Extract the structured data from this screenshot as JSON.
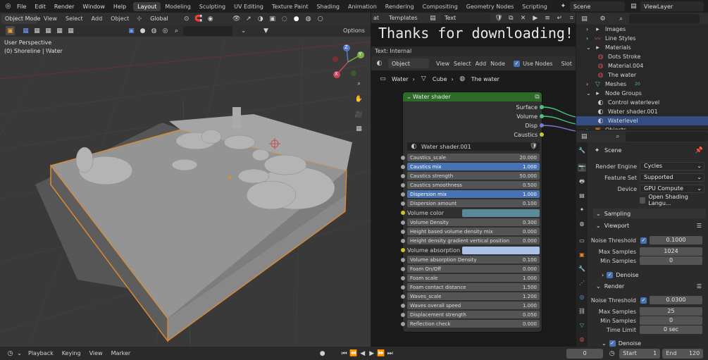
{
  "topbar": {
    "menus": [
      "File",
      "Edit",
      "Render",
      "Window",
      "Help"
    ],
    "workspaces": [
      "Layout",
      "Modeling",
      "Sculpting",
      "UV Editing",
      "Texture Paint",
      "Shading",
      "Animation",
      "Rendering",
      "Compositing",
      "Geometry Nodes",
      "Scripting"
    ],
    "active_workspace": "Layout",
    "scene": "Scene",
    "view_layer": "ViewLayer"
  },
  "viewport": {
    "mode": "Object Mode",
    "menus": [
      "View",
      "Select",
      "Add",
      "Object"
    ],
    "transform_orientation": "Global",
    "options_label": "Options",
    "overlay_title": "User Perspective",
    "overlay_subtitle": "(0) Shoreline | Water",
    "gizmo_axes": [
      "Z",
      "Y",
      "X"
    ]
  },
  "text_editor": {
    "label": "at",
    "templates": "Templates",
    "text_menu": "Text",
    "content": "Thanks for downloading!",
    "status": "Text: Internal"
  },
  "node_editor": {
    "object_mode": "Object",
    "menus": [
      "View",
      "Select",
      "Add",
      "Node"
    ],
    "use_nodes_label": "Use Nodes",
    "slot_label": "Slot",
    "breadcrumb": [
      "Water",
      "Cube",
      "The water"
    ],
    "node": {
      "title": "Water shader",
      "outputs": [
        "Surface",
        "Volume",
        "Disp",
        "Caustics"
      ],
      "group_name": "Water shader.001",
      "inputs": [
        {
          "label": "Caustics_scale",
          "value": "20.000",
          "selected": false
        },
        {
          "label": "Caustics mix",
          "value": "1.000",
          "selected": true
        },
        {
          "label": "Caustics strength",
          "value": "50.000",
          "selected": false
        },
        {
          "label": "Caustics smoothness",
          "value": "0.500",
          "selected": false
        },
        {
          "label": "Dispersion mix",
          "value": "1.000",
          "selected": true
        },
        {
          "label": "Dispersion amount",
          "value": "0.100",
          "selected": false
        }
      ],
      "volume_color_label": "Volume color",
      "volume_color": "#5a8a9a",
      "inputs2": [
        {
          "label": "Volume Density",
          "value": "0.300"
        },
        {
          "label": "Height based volume density mix",
          "value": "0.000"
        },
        {
          "label": "Height density gradient vertical position",
          "value": "0.000"
        }
      ],
      "absorption_color_label": "Volume absorption color",
      "absorption_color": "#aac2e6",
      "inputs3": [
        {
          "label": "Volume absorption Density",
          "value": "0.100"
        },
        {
          "label": "Foam On/Off",
          "value": "0.000"
        },
        {
          "label": "Foam scale",
          "value": "1.000"
        },
        {
          "label": "Foam contact distance",
          "value": "1.500"
        },
        {
          "label": "Waves_scale",
          "value": "1.200"
        },
        {
          "label": "Waves overall speed",
          "value": "1.000"
        },
        {
          "label": "Displacement strength",
          "value": "0.050"
        },
        {
          "label": "Reflection check",
          "value": "0.000"
        }
      ]
    }
  },
  "outliner": {
    "items": [
      {
        "label": "Images",
        "indent": 2,
        "icon": "folder-icon"
      },
      {
        "label": "Line Styles",
        "indent": 2,
        "icon": "linestyle-icon"
      },
      {
        "label": "Materials",
        "indent": 2,
        "icon": "folder-icon"
      },
      {
        "label": "Dots Stroke",
        "indent": 4,
        "icon": "material-icon"
      },
      {
        "label": "Material.004",
        "indent": 4,
        "icon": "material-icon"
      },
      {
        "label": "The water",
        "indent": 4,
        "icon": "material-icon"
      },
      {
        "label": "Meshes",
        "indent": 2,
        "icon": "mesh-icon",
        "badge": "20"
      },
      {
        "label": "Node Groups",
        "indent": 2,
        "icon": "folder-icon"
      },
      {
        "label": "Control waterlevel",
        "indent": 4,
        "icon": "nodegroup-icon"
      },
      {
        "label": "Water shader.001",
        "indent": 4,
        "icon": "nodegroup-icon"
      },
      {
        "label": "Waterlevel",
        "indent": 4,
        "icon": "nodegroup-icon",
        "selected": true
      },
      {
        "label": "Objects",
        "indent": 2,
        "icon": "object-icon"
      }
    ]
  },
  "properties": {
    "scene_label": "Scene",
    "render_engine_label": "Render Engine",
    "render_engine": "Cycles",
    "feature_set_label": "Feature Set",
    "feature_set": "Supported",
    "device_label": "Device",
    "device": "GPU Compute",
    "open_shading_label": "Open Shading Langu...",
    "sampling_label": "Sampling",
    "viewport_label": "Viewport",
    "noise_threshold_label": "Noise Threshold",
    "viewport_noise_threshold": "0.1000",
    "max_samples_label": "Max Samples",
    "viewport_max_samples": "1024",
    "min_samples_label": "Min Samples",
    "viewport_min_samples": "0",
    "denoise_label": "Denoise",
    "render_label": "Render",
    "render_noise_threshold": "0.0300",
    "render_max_samples": "25",
    "render_min_samples": "0",
    "time_limit_label": "Time Limit",
    "time_limit": "0 sec",
    "denoise2_label": "Denoise"
  },
  "timeline": {
    "menus": [
      "Playback",
      "Keying",
      "View",
      "Marker"
    ],
    "current_frame": "0",
    "start_label": "Start",
    "start": "1",
    "end_label": "End",
    "end": "120"
  }
}
